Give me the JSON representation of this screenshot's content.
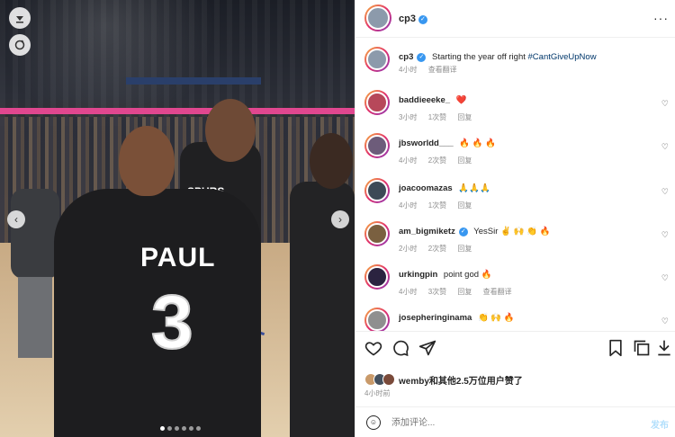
{
  "photo": {
    "jersey_name": "PAUL",
    "jersey_number": "3",
    "jersey_team_text": "SPURS",
    "overlay_icons": [
      "download-arrow-icon",
      "refresh-icon"
    ],
    "carousel_dots": 6,
    "carousel_active_index": 0
  },
  "header": {
    "username": "cp3",
    "verified": true,
    "more": "···"
  },
  "comments": [
    {
      "username": "cp3",
      "verified": true,
      "text": "Starting the year off right ",
      "hashtag": "#CantGiveUpNow",
      "meta": [
        "4小时",
        "查看翻译"
      ],
      "avatar_color": "#8c9aab"
    },
    {
      "username": "baddieeeke_",
      "text": "❤️",
      "meta": [
        "3小时",
        "1次赞",
        "回复"
      ],
      "avatar_color": "#b7485a"
    },
    {
      "username": "jbsworldd___",
      "text": "🔥 🔥 🔥",
      "meta": [
        "4小时",
        "2次赞",
        "回复"
      ],
      "avatar_color": "#6d5c7a"
    },
    {
      "username": "joacoomazas",
      "text": "🙏🙏🙏",
      "meta": [
        "4小时",
        "1次赞",
        "回复"
      ],
      "avatar_color": "#3d4a57"
    },
    {
      "username": "am_bigmiketz",
      "verified": true,
      "text": "YesSir ✌️ 🙌 👏 🔥",
      "meta": [
        "2小时",
        "2次赞",
        "回复"
      ],
      "avatar_color": "#7a6040"
    },
    {
      "username": "urkingpin",
      "text": "point god 🔥",
      "meta": [
        "4小时",
        "3次赞",
        "回复",
        "查看翻译"
      ],
      "avatar_color": "#2b2340"
    },
    {
      "username": "josepheringinama",
      "text": "👏 🙌 🔥",
      "meta": [],
      "avatar_color": "#8f8f8f"
    }
  ],
  "actions": {
    "icons": [
      "heart-icon",
      "comment-icon",
      "share-icon",
      "save-icon",
      "copy-icon",
      "download-icon"
    ]
  },
  "likes": {
    "text": "wemby和其他2.5万位用户赞了",
    "avatar_colors": [
      "#c99a6a",
      "#44505e",
      "#7a4a3a"
    ]
  },
  "time": "4小时前",
  "comment_bar": {
    "placeholder": "添加评论...",
    "post_label": "发布"
  }
}
